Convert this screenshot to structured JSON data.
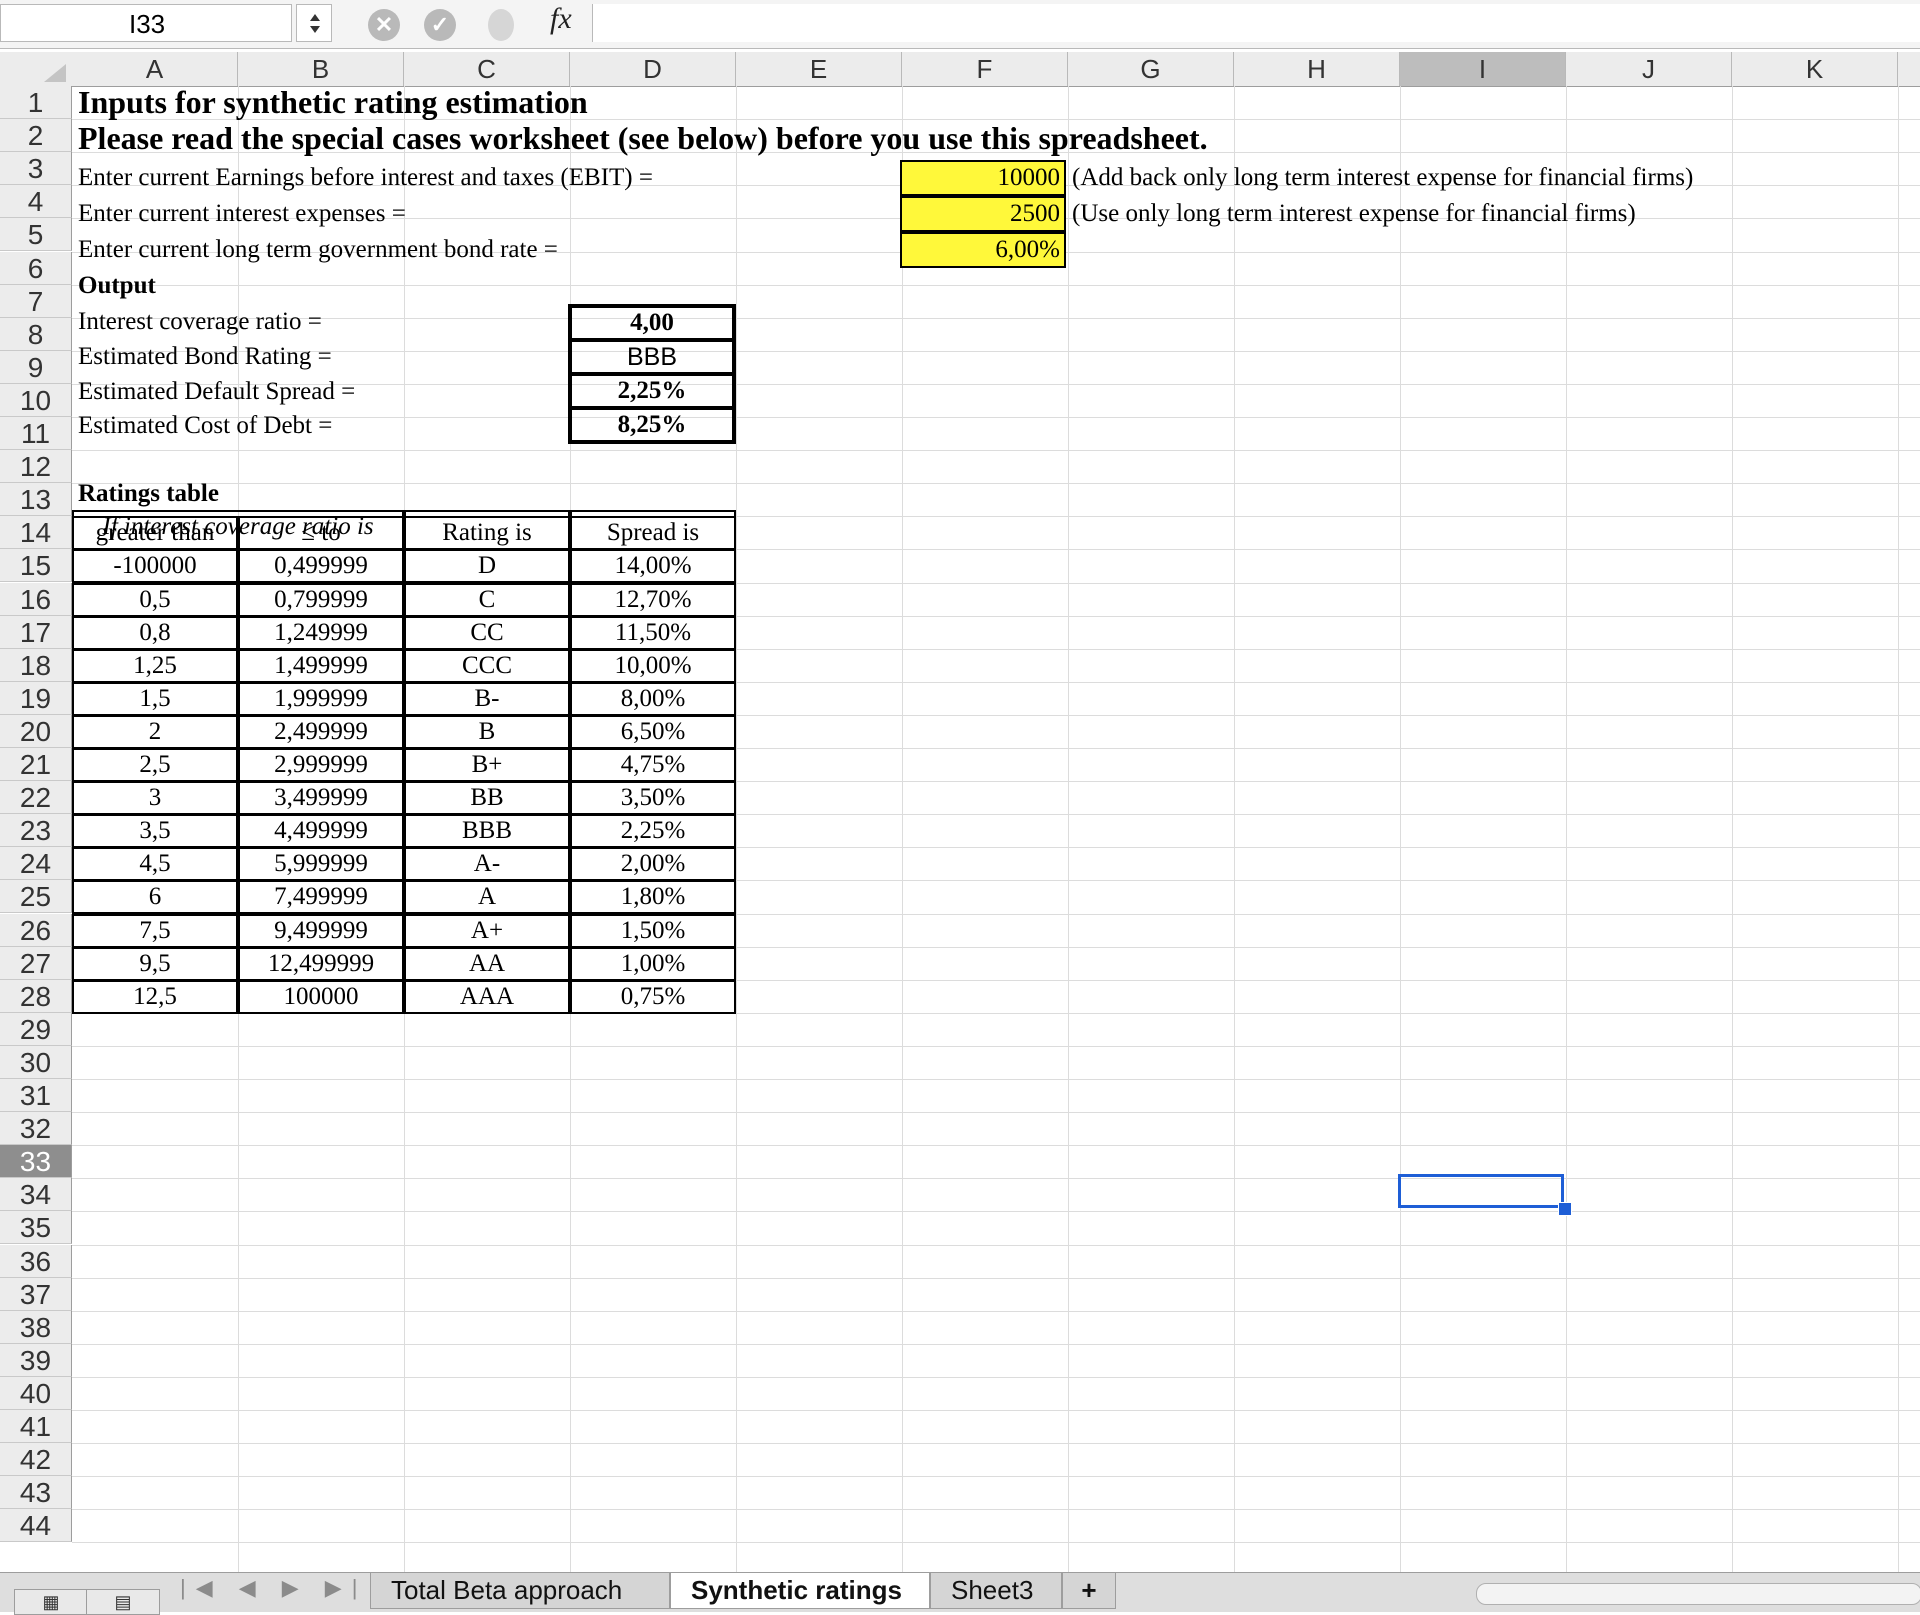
{
  "formula_bar": {
    "name_box": "I33",
    "cancel_icon": "✕",
    "confirm_icon": "✓",
    "fx_label": "fx",
    "formula": ""
  },
  "columns": [
    "A",
    "B",
    "C",
    "D",
    "E",
    "F",
    "G",
    "H",
    "I",
    "J",
    "K"
  ],
  "selected_column": "I",
  "rows": [
    "1",
    "2",
    "3",
    "4",
    "5",
    "6",
    "7",
    "8",
    "9",
    "10",
    "11",
    "12",
    "13",
    "14",
    "15",
    "16",
    "17",
    "18",
    "19",
    "20",
    "21",
    "22",
    "23",
    "24",
    "25",
    "26",
    "27",
    "28",
    "29",
    "30",
    "31",
    "32",
    "33",
    "34",
    "35",
    "36",
    "37",
    "38",
    "39",
    "40",
    "41",
    "42",
    "43",
    "44"
  ],
  "selected_row": "33",
  "selected_cell": "I33",
  "sheet": {
    "title": "Inputs for synthetic rating estimation",
    "subtitle": "Please read the special cases worksheet (see below) before you use this spreadsheet.",
    "inputs": [
      {
        "label": "Enter current Earnings before interest and taxes (EBIT) =",
        "value": "10000",
        "note": "(Add back only long term interest expense for financial firms)"
      },
      {
        "label": "Enter current interest expenses =",
        "value": "2500",
        "note": "(Use only long term interest expense for financial firms)"
      },
      {
        "label": "Enter current long term government bond rate =",
        "value": "6,00%",
        "note": ""
      }
    ],
    "output_heading": "Output",
    "outputs": [
      {
        "label": "Interest  coverage ratio =",
        "value": "4,00"
      },
      {
        "label": "Estimated Bond Rating =",
        "value": "BBB"
      },
      {
        "label": "Estimated Default Spread =",
        "value": "2,25%"
      },
      {
        "label": "Estimated Cost of Debt =",
        "value": "8,25%"
      }
    ],
    "ratings_heading": "Ratings table",
    "ratings_subheading": "If interest coverage ratio is",
    "ratings_columns": [
      "greater than",
      "≤ to",
      "Rating is",
      "Spread is"
    ],
    "ratings_rows": [
      [
        "-100000",
        "0,499999",
        "D",
        "14,00%"
      ],
      [
        "0,5",
        "0,799999",
        "C",
        "12,70%"
      ],
      [
        "0,8",
        "1,249999",
        "CC",
        "11,50%"
      ],
      [
        "1,25",
        "1,499999",
        "CCC",
        "10,00%"
      ],
      [
        "1,5",
        "1,999999",
        "B-",
        "8,00%"
      ],
      [
        "2",
        "2,499999",
        "B",
        "6,50%"
      ],
      [
        "2,5",
        "2,999999",
        "B+",
        "4,75%"
      ],
      [
        "3",
        "3,499999",
        "BB",
        "3,50%"
      ],
      [
        "3,5",
        "4,499999",
        "BBB",
        "2,25%"
      ],
      [
        "4,5",
        "5,999999",
        "A-",
        "2,00%"
      ],
      [
        "6",
        "7,499999",
        "A",
        "1,80%"
      ],
      [
        "7,5",
        "9,499999",
        "A+",
        "1,50%"
      ],
      [
        "9,5",
        "12,499999",
        "AA",
        "1,00%"
      ],
      [
        "12,5",
        "100000",
        "AAA",
        "0,75%"
      ]
    ]
  },
  "tabs": {
    "nav_arrows": "|◀ ◀ ▶ ▶|",
    "items": [
      "Total Beta approach",
      "Synthetic ratings",
      "Sheet3"
    ],
    "active": "Synthetic ratings",
    "add_label": "+"
  },
  "colors": {
    "input_fill": "#fff83a",
    "selection": "#1e5ed6"
  }
}
